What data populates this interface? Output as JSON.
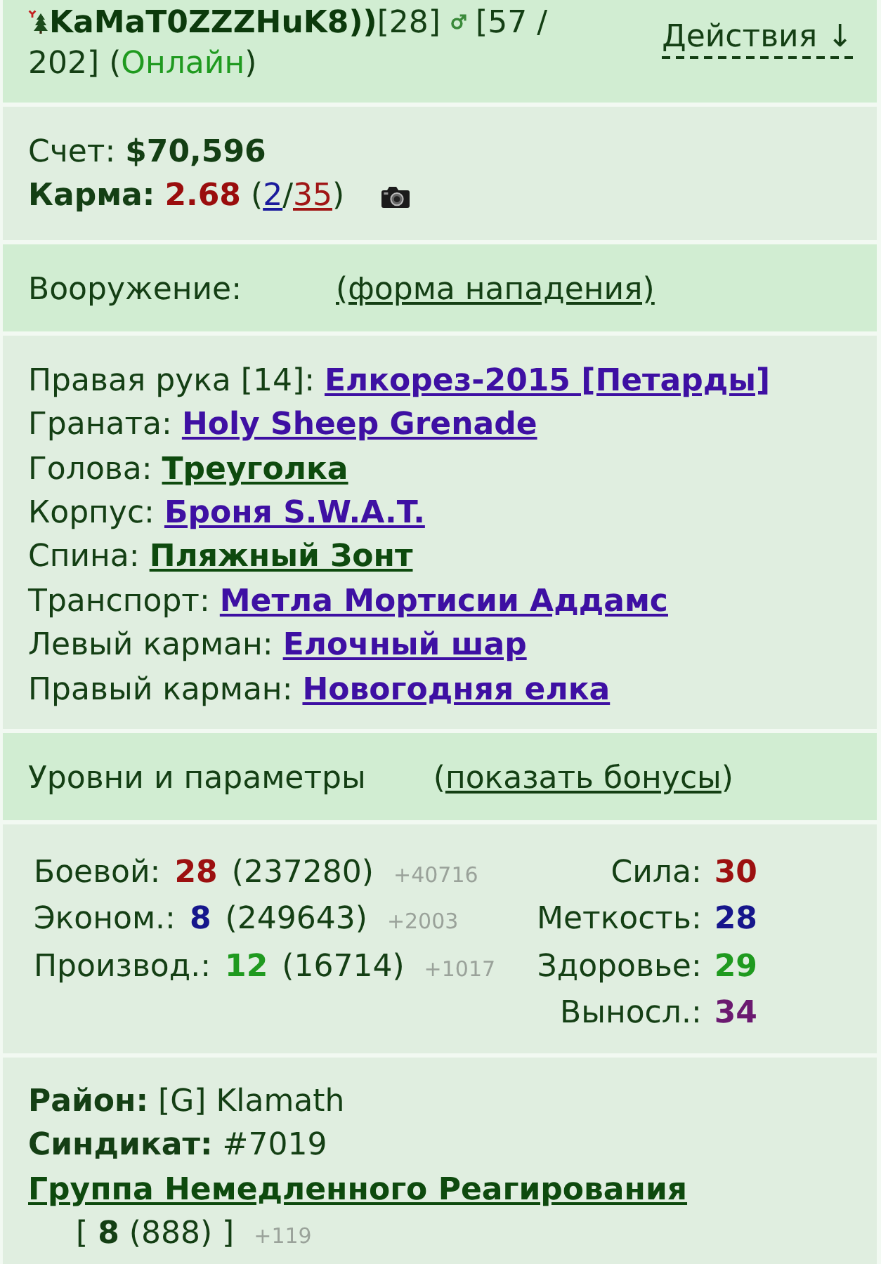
{
  "profile": {
    "name": "KaMaT0ZZZHuK8))",
    "rank": "[28]",
    "health": "[57 / 202]",
    "status_open": "(",
    "status": "Онлайн",
    "status_close": ")",
    "actions": "Действия ↓"
  },
  "account": {
    "balance": "Счет: **$70,596**",
    "karma_label": "Карма:",
    "karma": "2.68",
    "karma_open": "(",
    "karma_plus": "2",
    "karma_separator": "/",
    "karma_minus": "35",
    "karma_close": ")"
  },
  "weapons_header": {
    "title": "Вооружение:",
    "link": "(форма нападения)"
  },
  "equipment": [
    {
      "slot": "Правая рука [14]:",
      "item": "Елкорез-2015 [Петарды]",
      "color": "#3e10a3"
    },
    {
      "slot": "Граната:",
      "item": "Holy Sheep Grenade",
      "color": "#3e10a3"
    },
    {
      "slot": "Голова:",
      "item": "Треуголка",
      "color": "#0e4a0e"
    },
    {
      "slot": "Корпус:",
      "item": "Броня S.W.A.T.",
      "color": "#3e10a3"
    },
    {
      "slot": "Спина:",
      "item": "Пляжный Зонт",
      "color": "#0e4a0e"
    },
    {
      "slot": "Транспорт:",
      "item": "Метла Мортисии Аддамс",
      "color": "#3e10a3"
    },
    {
      "slot": "Левый карман:",
      "item": "Елочный шар",
      "color": "#3e10a3"
    },
    {
      "slot": "Правый карман:",
      "item": "Новогодняя елка",
      "color": "#3e10a3"
    }
  ],
  "levels_header": {
    "title": "Уровни и параметры",
    "open": "(",
    "link": "показать бонусы",
    "close": ")"
  },
  "skills": [
    {
      "label": "Боевой:",
      "value": "28",
      "experience": "(237280)",
      "bonus": "+40716",
      "color": "#9c1010"
    },
    {
      "label": "Эконом.:",
      "value": "8",
      "experience": "(249643)",
      "bonus": "+2003",
      "color": "#16168c"
    },
    {
      "label": "Производ.:",
      "value": "12",
      "experience": "(16714)",
      "bonus": "+1017",
      "color": "#1f9a1f"
    }
  ],
  "attributes": [
    {
      "label": "Сила:",
      "value": "30",
      "color": "#9c1010"
    },
    {
      "label": "Меткость:",
      "value": "28",
      "color": "#16168c"
    },
    {
      "label": "Здоровье:",
      "value": "29",
      "color": "#1f9a1f"
    },
    {
      "label": "Выносл.:",
      "value": "34",
      "color": "#6b1a70"
    }
  ],
  "affiliation": {
    "district": "**Район:** [G] Klamath",
    "syndicate_label": "Синдикат:",
    "syndicate_number": "#7019",
    "syndicate": "Группа Немедленного Реагирования",
    "syndicate_level": "[ **8** (888) ]",
    "syndicate_bonus": "+119"
  }
}
